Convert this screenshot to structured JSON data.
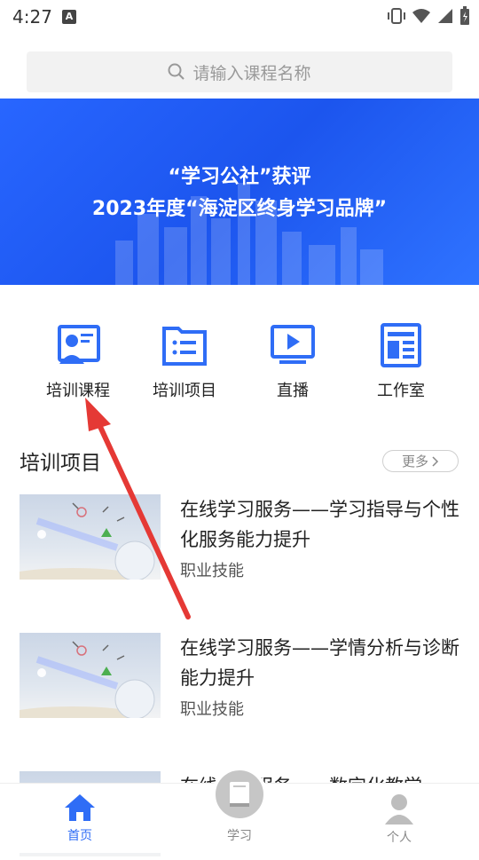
{
  "status_bar": {
    "time": "4:27",
    "notif": "A"
  },
  "search": {
    "placeholder": "请输入课程名称"
  },
  "banner": {
    "line1": "“学习公社”获评",
    "line2": "2023年度“海淀区终身学习品牌”"
  },
  "quick_links": [
    {
      "label": "培训课程",
      "icon": "course-teacher-icon"
    },
    {
      "label": "培训项目",
      "icon": "folder-list-icon"
    },
    {
      "label": "直播",
      "icon": "live-play-icon"
    },
    {
      "label": "工作室",
      "icon": "document-layout-icon"
    }
  ],
  "section": {
    "title": "培训项目",
    "more": "更多"
  },
  "courses": [
    {
      "title": "在线学习服务——学习指导与个性化服务能力提升",
      "category": "职业技能"
    },
    {
      "title": "在线学习服务——学情分析与诊断能力提升",
      "category": "职业技能"
    },
    {
      "title": "在线学习服务——数字化教学"
    }
  ],
  "tabs": [
    {
      "label": "首页",
      "icon": "home-icon",
      "active": true
    },
    {
      "label": "学习",
      "icon": "book-icon",
      "active": false
    },
    {
      "label": "个人",
      "icon": "person-icon",
      "active": false
    }
  ],
  "colors": {
    "accent": "#2f6df6",
    "banner": "#1c55ee",
    "annotation_arrow": "#e53935"
  }
}
